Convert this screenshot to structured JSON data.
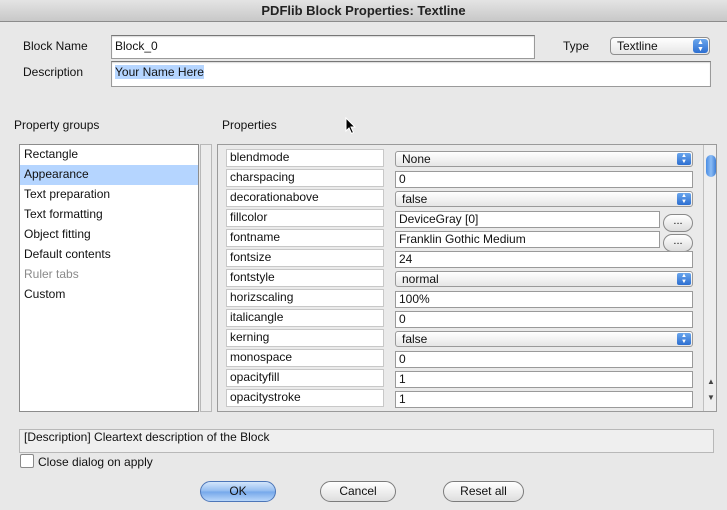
{
  "window": {
    "title": "PDFlib Block Properties: Textline"
  },
  "block_name": {
    "label": "Block Name",
    "value": "Block_0"
  },
  "type": {
    "label": "Type",
    "value": "Textline"
  },
  "description": {
    "label": "Description",
    "value": "Your Name Here"
  },
  "property_groups": {
    "header": "Property groups",
    "items": [
      {
        "label": "Rectangle",
        "state": "normal"
      },
      {
        "label": "Appearance",
        "state": "selected"
      },
      {
        "label": "Text preparation",
        "state": "normal"
      },
      {
        "label": "Text formatting",
        "state": "normal"
      },
      {
        "label": "Object fitting",
        "state": "normal"
      },
      {
        "label": "Default contents",
        "state": "normal"
      },
      {
        "label": "Ruler tabs",
        "state": "disabled"
      },
      {
        "label": "Custom",
        "state": "normal"
      }
    ]
  },
  "properties": {
    "header": "Properties",
    "rows": [
      {
        "name": "blendmode",
        "value": "None",
        "control": "popup"
      },
      {
        "name": "charspacing",
        "value": "0",
        "control": "field"
      },
      {
        "name": "decorationabove",
        "value": "false",
        "control": "popup"
      },
      {
        "name": "fillcolor",
        "value": "DeviceGray [0]",
        "control": "field-button",
        "button": "..."
      },
      {
        "name": "fontname",
        "value": "Franklin Gothic Medium",
        "control": "field-button",
        "button": "..."
      },
      {
        "name": "fontsize",
        "value": "24",
        "control": "field"
      },
      {
        "name": "fontstyle",
        "value": "normal",
        "control": "popup"
      },
      {
        "name": "horizscaling",
        "value": "100%",
        "control": "field"
      },
      {
        "name": "italicangle",
        "value": "0",
        "control": "field"
      },
      {
        "name": "kerning",
        "value": "false",
        "control": "popup"
      },
      {
        "name": "monospace",
        "value": "0",
        "control": "field"
      },
      {
        "name": "opacityfill",
        "value": "1",
        "control": "field"
      },
      {
        "name": "opacitystroke",
        "value": "1",
        "control": "field"
      }
    ]
  },
  "status": {
    "text": "[Description] Cleartext description of the Block"
  },
  "close_on_apply": {
    "label": "Close dialog on apply",
    "checked": false
  },
  "buttons": {
    "ok": "OK",
    "cancel": "Cancel",
    "reset_all": "Reset all"
  },
  "colors": {
    "selection": "#b5d5ff",
    "accent": "#2d6fd1"
  }
}
